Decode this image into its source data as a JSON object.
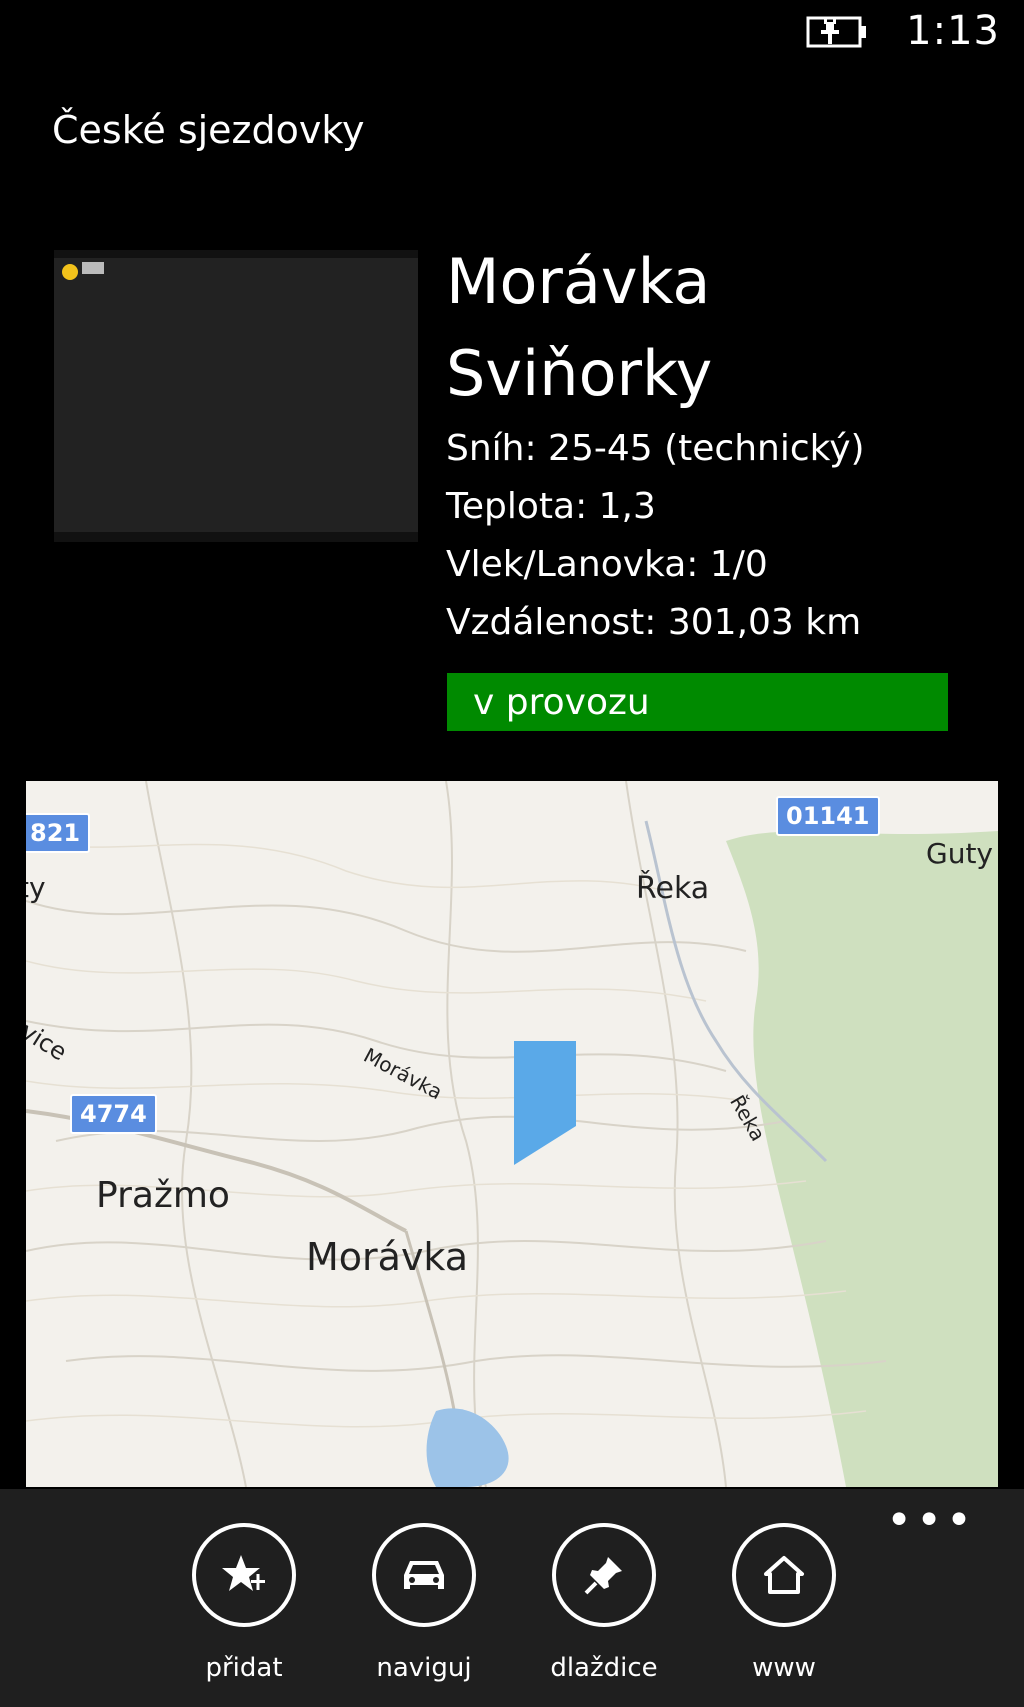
{
  "status": {
    "time": "1:13",
    "battery_icon": "battery-charging-icon"
  },
  "app": {
    "title": "České sjezdovky"
  },
  "resort": {
    "name_line1": "Morávka",
    "name_line2": "Sviňorky",
    "snow": "Sníh: 25-45 (technický)",
    "temperature": "Teplota: 1,3",
    "lifts": "Vlek/Lanovka: 1/0",
    "distance": "Vzdálenost: 301,03 km",
    "status": "v provozu",
    "status_color": "#008a00"
  },
  "map": {
    "places": [
      "Řeka",
      "Morávka",
      "Pražmo",
      "Morávka",
      "Řeka",
      "Guty",
      "ty",
      "ovice"
    ],
    "roads": [
      "821",
      "01141",
      "4774"
    ],
    "colors": {
      "land": "#f3f1ec",
      "forest": "#cfe0bf",
      "water": "#9cc3e8",
      "marker": "#5aa9e8"
    }
  },
  "appbar": {
    "buttons": [
      {
        "label": "přidat",
        "icon": "star-add-icon"
      },
      {
        "label": "naviguj",
        "icon": "car-icon"
      },
      {
        "label": "dlaždice",
        "icon": "pin-icon"
      },
      {
        "label": "www",
        "icon": "home-icon"
      }
    ],
    "more": "•••"
  }
}
